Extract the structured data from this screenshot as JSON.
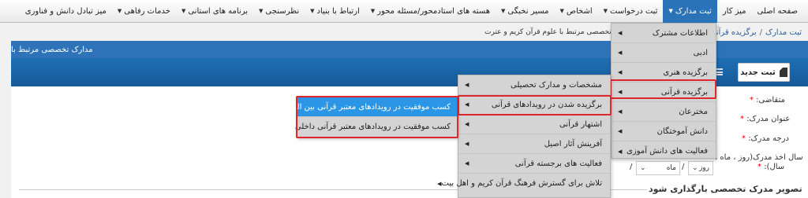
{
  "nav": {
    "items": [
      {
        "label": "صفحه اصلی",
        "caret": false,
        "active": false
      },
      {
        "label": "میز کار",
        "caret": false,
        "active": false
      },
      {
        "label": "ثبت مدارک",
        "caret": true,
        "active": true
      },
      {
        "label": "ثبت درخواست",
        "caret": true,
        "active": false
      },
      {
        "label": "اشخاص",
        "caret": true,
        "active": false
      },
      {
        "label": "مسیر نخبگی",
        "caret": true,
        "active": false
      },
      {
        "label": "هسته های استادمحور/مسئله محور",
        "caret": true,
        "active": false
      },
      {
        "label": "ارتباط با بنیاد",
        "caret": true,
        "active": false
      },
      {
        "label": "نظرسنجی",
        "caret": true,
        "active": false
      },
      {
        "label": "برنامه های استانی",
        "caret": true,
        "active": false
      },
      {
        "label": "خدمات رفاهی",
        "caret": true,
        "active": false
      },
      {
        "label": "میز تبادل دانش و فناوری",
        "caret": false,
        "active": false
      }
    ]
  },
  "breadcrumb": {
    "item1": "ثبت مدارک",
    "sep": "/",
    "item2": "برگزیده قرآنی"
  },
  "subtitle": "مدارک تخصصی مرتبط با علوم قرآن کریم و عترت",
  "panel": {
    "title": "مدارک تخصصی مرتبط با"
  },
  "toolbar": {
    "new_label": "ثبت جدید"
  },
  "form": {
    "applicant_label": "متقاضی:",
    "doc_title_label": "عنوان مدرک:",
    "doc_degree_label": "درجه مدرک:",
    "date_label": "سال اخذ مدرک(روز ، ماه ،",
    "year_label": "سال):",
    "required_mark": "*",
    "day_value": "روز",
    "month_value": "ماه",
    "slash": "/",
    "section_title": "تصویر مدرک تخصصی بارگذاری شود"
  },
  "menu1": {
    "items": [
      {
        "label": "اطلاعات مشترک",
        "arrow": true
      },
      {
        "label": "ادبی",
        "arrow": true
      },
      {
        "label": "برگزیده هنری",
        "arrow": true
      },
      {
        "label": "برگزیده قرآنی",
        "arrow": true
      },
      {
        "label": "مخترعان",
        "arrow": true
      },
      {
        "label": "دانش آموختگان",
        "arrow": true
      },
      {
        "label": "فعالیت های دانش آموزی",
        "arrow": true
      }
    ]
  },
  "menu2": {
    "items": [
      {
        "label": "مشخصات و مدارک تحصیلی",
        "arrow": true
      },
      {
        "label": "برگزیده شدن در رویدادهای قرآنی",
        "arrow": true
      },
      {
        "label": "اشتهار قرآنی",
        "arrow": true
      },
      {
        "label": "آفرینش آثار اصیل",
        "arrow": true
      },
      {
        "label": "فعالیت های برجسته قرآنی",
        "arrow": true
      },
      {
        "label": "تلاش برای گسترش فرهنگ قرآن کریم و اهل بیت",
        "arrow": true
      }
    ]
  },
  "menu3": {
    "items": [
      {
        "label": "کسب موفقیت در رویدادهای معتبر قرآنی بین المللی"
      },
      {
        "label": "کسب موفقیت در رویدادهای معتبر قرآنی داخلی"
      }
    ]
  },
  "colors": {
    "accent": "#2a73b8",
    "highlight": "#e0262c",
    "selected": "#2b95e6"
  }
}
